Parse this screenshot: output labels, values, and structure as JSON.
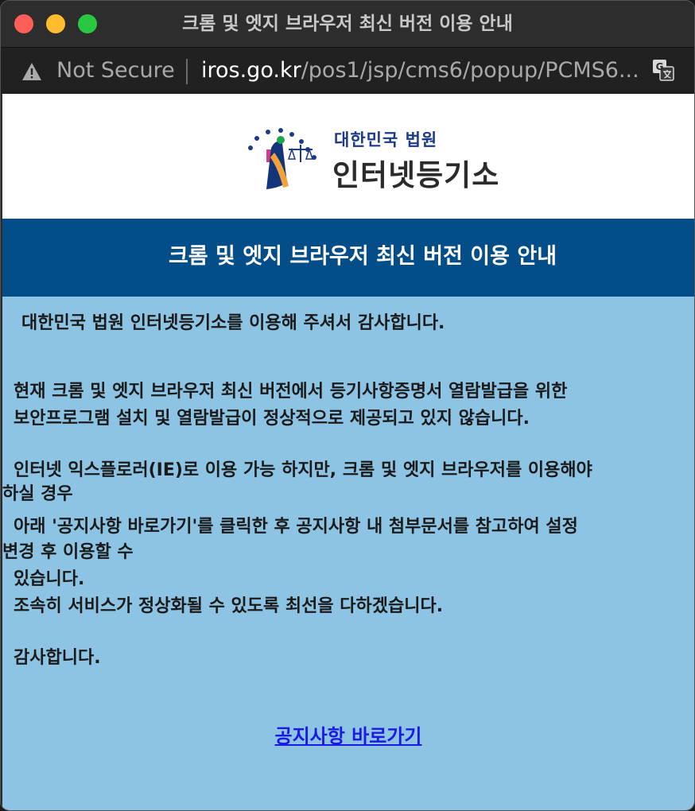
{
  "window": {
    "title": "크롬 및 엣지 브라우저 최신 버전 이용 안내"
  },
  "address_bar": {
    "security_label": "Not Secure",
    "url_host": "iros.go.kr",
    "url_path": "/pos1/jsp/cms6/popup/PCMS6..."
  },
  "logo": {
    "org_name": "대한민국 법원",
    "service_name": "인터넷등기소"
  },
  "header": {
    "title": "크롬 및 엣지 브라우저 최신 버전 이용 안내"
  },
  "body": {
    "greeting": "대한민국 법원 인터넷등기소를 이용해 주셔서 감사합니다.",
    "line1": "현재 크롬 및 엣지 브라우저 최신 버전에서 등기사항증명서 열람발급을 위한",
    "line2": "보안프로그램 설치 및 열람발급이 정상적으로 제공되고 있지 않습니다.",
    "line3": "인터넷 익스플로러(IE)로 이용 가능 하지만, 크롬 및 엣지 브라우저를 이용해야",
    "line4": "하실 경우",
    "line5": "아래 '공지사항 바로가기'를 클릭한 후 공지사항 내 첨부문서를 참고하여 설정",
    "line6": "변경 후 이용할 수",
    "line7": "있습니다.",
    "line8": "조속히 서비스가 정상화될 수 있도록 최선을 다하겠습니다.",
    "closing": "감사합니다.",
    "link_label": "공지사항 바로가기"
  },
  "colors": {
    "header_bg": "#034d89",
    "content_bg": "#8dc4e4",
    "link": "#1a1ae6"
  }
}
